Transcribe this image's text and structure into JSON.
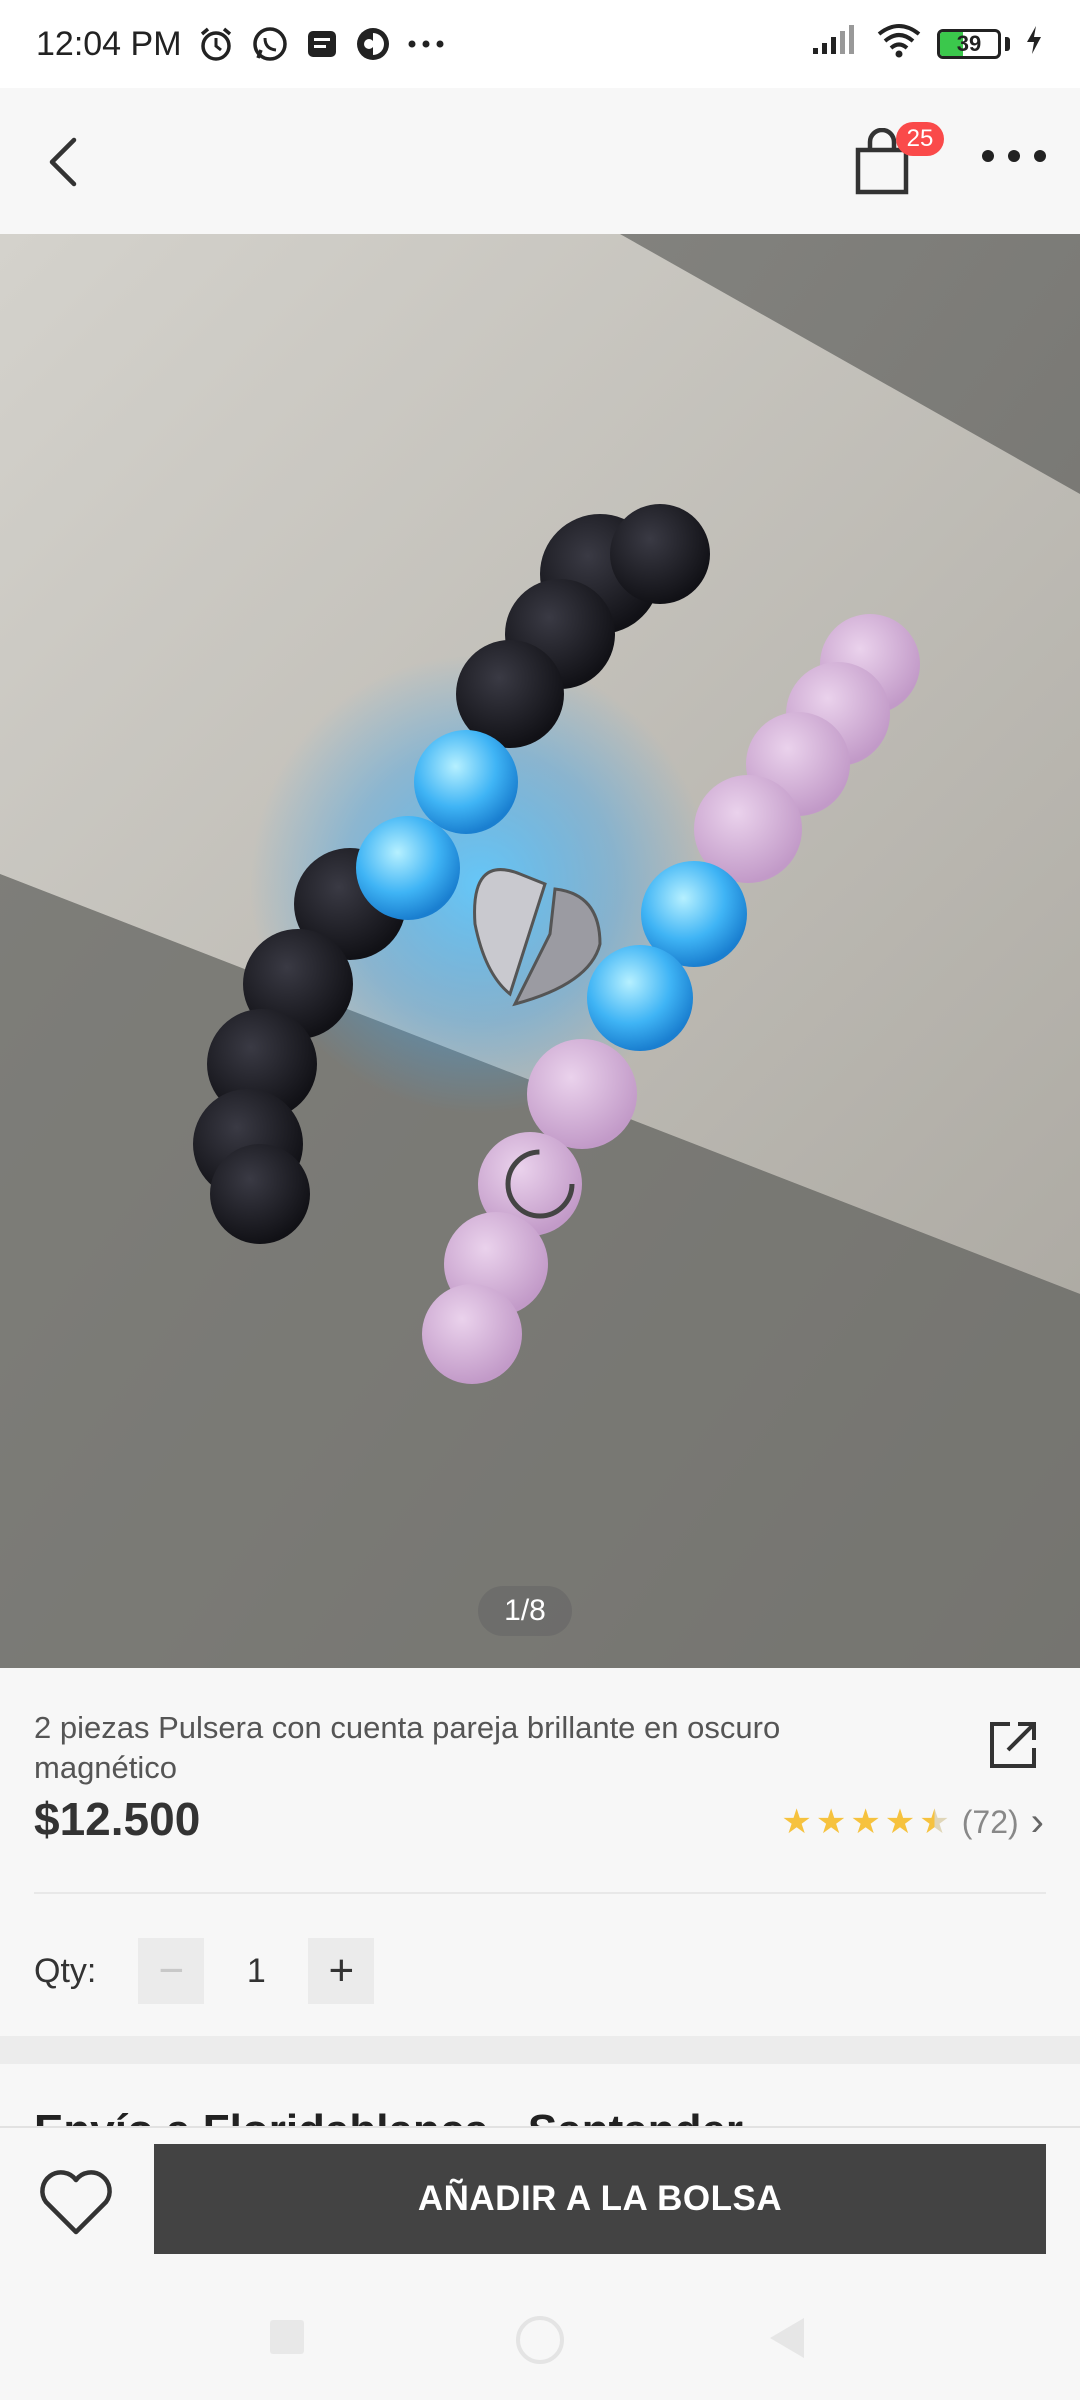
{
  "status_bar": {
    "time": "12:04 PM",
    "battery": "39",
    "icons": [
      "alarm-icon",
      "whatsapp-icon",
      "message-icon",
      "app-icon",
      "more-dots-icon",
      "signal-icon",
      "wifi-icon",
      "battery-icon",
      "charging-icon"
    ]
  },
  "topbar": {
    "cart_count": "25"
  },
  "gallery": {
    "page_indicator": "1/8"
  },
  "product": {
    "title": "2 piezas Pulsera con cuenta pareja brillante en oscuro magnético",
    "price": "$12.500",
    "rating_value": 4.5,
    "rating_count": "(72)"
  },
  "quantity": {
    "label": "Qty:",
    "value": "1",
    "minus": "−",
    "plus": "+"
  },
  "shipping": {
    "text": "Envío a Floridablanca - Santander"
  },
  "actions": {
    "add_to_bag": "AÑADIR A LA BOLSA"
  },
  "colors": {
    "add_button_bg": "#434343",
    "badge_bg": "#fa4a4a",
    "star": "#f6c23e",
    "battery_fill": "#3bc84c"
  }
}
